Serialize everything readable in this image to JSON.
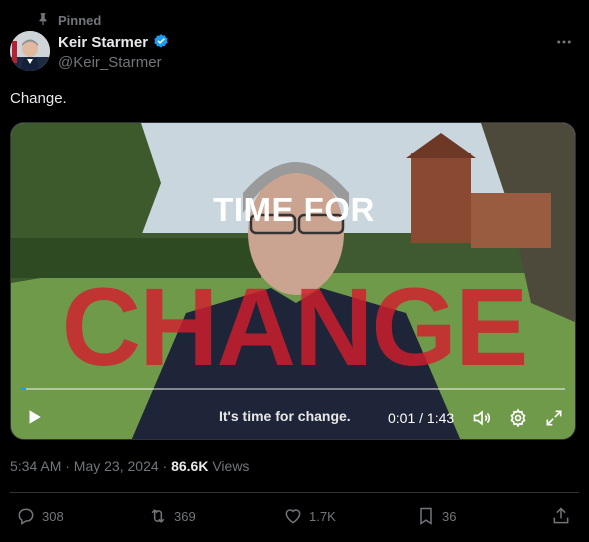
{
  "pinned_label": "Pinned",
  "author": {
    "name": "Keir Starmer",
    "handle": "@Keir_Starmer",
    "verified": true
  },
  "tweet": {
    "text": "Change."
  },
  "video": {
    "overlay_title": "TIME FOR",
    "overlay_word": "CHANGE",
    "caption": "It's time for change.",
    "time_display": "0:01 / 1:43",
    "progress_fraction": 0.01,
    "accent_color": "#1d9bf0",
    "overlay_word_color": "#d21e2d"
  },
  "meta": {
    "timestamp": "5:34 AM · May 23, 2024 · ",
    "views_count": "86.6K",
    "views_label": " Views"
  },
  "actions": {
    "replies": "308",
    "reposts": "369",
    "likes": "1.7K",
    "bookmarks": "36"
  },
  "icons": [
    "pin-icon",
    "verified-badge-icon",
    "more-icon",
    "play-icon",
    "volume-icon",
    "settings-gear-icon",
    "fullscreen-icon",
    "reply-icon",
    "repost-icon",
    "like-icon",
    "bookmark-icon",
    "share-icon"
  ]
}
